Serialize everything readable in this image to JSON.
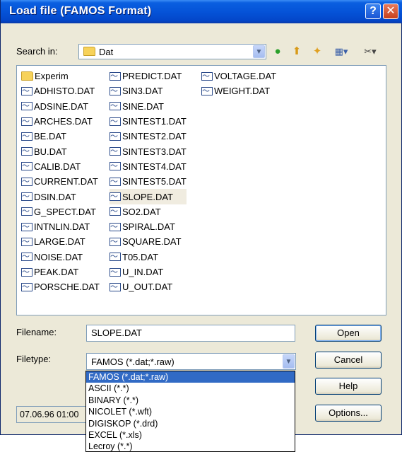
{
  "window": {
    "title": "Load file  (FAMOS Format)"
  },
  "titlebar": {
    "help_glyph": "?",
    "close_glyph": "✕"
  },
  "search": {
    "label": "Search in:",
    "value": "Dat"
  },
  "toolbar": {
    "back_glyph": "●",
    "up_glyph": "⬆",
    "newfolder_glyph": "✦",
    "view_glyph": "▦▾",
    "tools_glyph": "✂▾"
  },
  "files": {
    "col1": [
      "Experim",
      "ADHISTO.DAT",
      "ADSINE.DAT",
      "ARCHES.DAT",
      "BE.DAT",
      "BU.DAT",
      "CALIB.DAT",
      "CURRENT.DAT",
      "DSIN.DAT",
      "G_SPECT.DAT",
      "INTNLIN.DAT",
      "LARGE.DAT",
      "NOISE.DAT",
      "PEAK.DAT",
      "PORSCHE.DAT"
    ],
    "col2": [
      "PREDICT.DAT",
      "SIN3.DAT",
      "SINE.DAT",
      "SINTEST1.DAT",
      "SINTEST2.DAT",
      "SINTEST3.DAT",
      "SINTEST4.DAT",
      "SINTEST5.DAT",
      "SLOPE.DAT",
      "SO2.DAT",
      "SPIRAL.DAT",
      "SQUARE.DAT",
      "T05.DAT",
      "U_IN.DAT",
      "U_OUT.DAT"
    ],
    "col3": [
      "VOLTAGE.DAT",
      "WEIGHT.DAT"
    ],
    "selected": "SLOPE.DAT"
  },
  "filename": {
    "label": "Filename:",
    "value": "SLOPE.DAT"
  },
  "filetype": {
    "label": "Filetype:",
    "value": "FAMOS  (*.dat;*.raw)",
    "options": [
      "FAMOS  (*.dat;*.raw)",
      "ASCII    (*.*)",
      "BINARY  (*.*)",
      "NICOLET  (*.wft)",
      "DIGISKOP  (*.drd)",
      "EXCEL  (*.xls)",
      "Lecroy   (*.*)"
    ]
  },
  "buttons": {
    "open": "Open",
    "cancel": "Cancel",
    "help": "Help",
    "options": "Options..."
  },
  "status": {
    "text": "07.06.96 01:00"
  }
}
